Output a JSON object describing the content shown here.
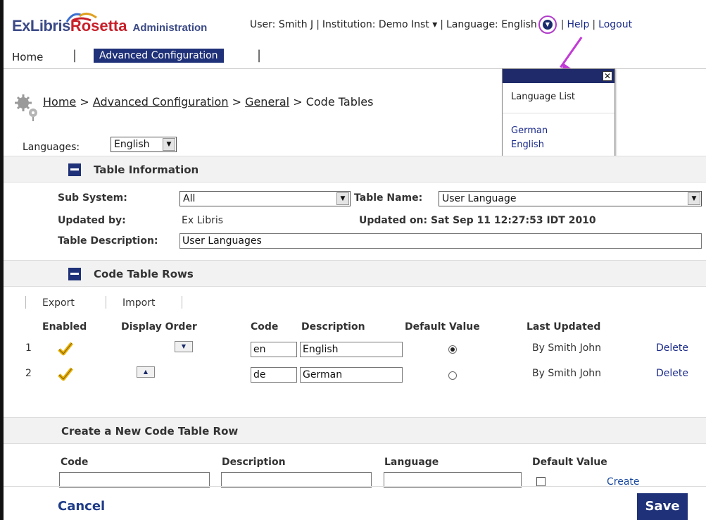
{
  "app": {
    "logo_ex": "ExLibris",
    "logo_rosetta": "Rosetta",
    "logo_admin": "Administration"
  },
  "topbar": {
    "user": "User: Smith J",
    "institution": "Institution: Demo Inst",
    "institution_caret": "▾",
    "language": "Language: English",
    "help": "Help",
    "logout": "Logout"
  },
  "nav": {
    "home": "Home",
    "advanced": "Advanced Configuration"
  },
  "breadcrumb": {
    "home": "Home",
    "advanced": "Advanced Configuration",
    "general": "General",
    "current": "Code Tables",
    "sep": ">"
  },
  "languages_filter": {
    "label": "Languages:",
    "value": "English"
  },
  "popup": {
    "title": "Language List",
    "items": [
      "German",
      "English"
    ],
    "close": "✕"
  },
  "table_info": {
    "title": "Table Information",
    "sub_system_label": "Sub System:",
    "sub_system_value": "All",
    "table_name_label": "Table Name:",
    "table_name_value": "User Language",
    "updated_by_label": "Updated by:",
    "updated_by_value": "Ex Libris",
    "updated_on": "Updated on: Sat Sep 11 12:27:53 IDT 2010",
    "description_label": "Table Description:",
    "description_value": "User Languages"
  },
  "code_rows": {
    "title": "Code Table Rows",
    "export": "Export",
    "import": "Import",
    "headers": [
      "Enabled",
      "Display Order",
      "Code",
      "Description",
      "Default Value",
      "Last Updated"
    ],
    "rows": [
      {
        "num": "1",
        "code": "en",
        "description": "English",
        "default": true,
        "last_updated": "By Smith John",
        "delete": "Delete"
      },
      {
        "num": "2",
        "code": "de",
        "description": "German",
        "default": false,
        "last_updated": "By Smith John",
        "delete": "Delete"
      }
    ]
  },
  "new_row": {
    "title": "Create a New Code Table Row",
    "code_label": "Code",
    "description_label": "Description",
    "language_label": "Language",
    "default_label": "Default Value",
    "create": "Create",
    "code_value": "",
    "description_value": "",
    "language_value": ""
  },
  "footer": {
    "cancel": "Cancel",
    "save": "Save"
  },
  "colors": {
    "navy": "#1f3178",
    "accent_pointer": "#c23ad6",
    "brand_red": "#c8202a"
  }
}
